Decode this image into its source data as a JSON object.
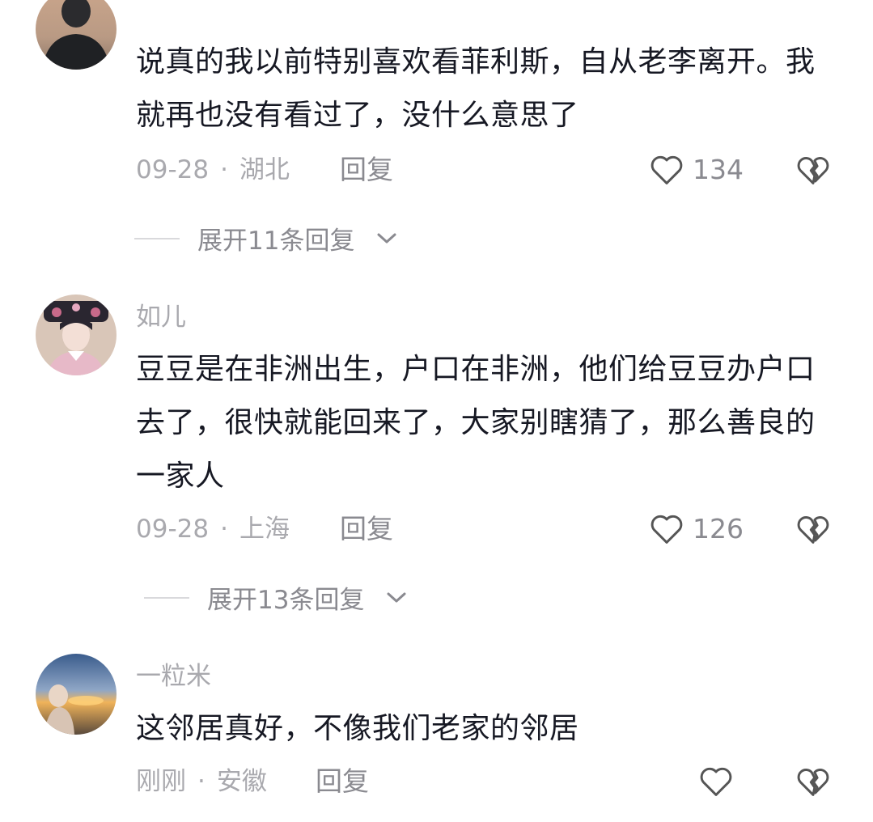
{
  "comments": [
    {
      "username": "",
      "text": "说真的我以前特别喜欢看菲利斯，自从老李离开。我就再也没有看过了，没什么意思了",
      "date": "09-28",
      "location": "湖北",
      "reply_label": "回复",
      "likes": "134",
      "expand_label": "展开11条回复"
    },
    {
      "username": "如儿",
      "text": "豆豆是在非洲出生，户口在非洲，他们给豆豆办户口去了，很快就能回来了，大家别瞎猜了，那么善良的一家人",
      "date": "09-28",
      "location": "上海",
      "reply_label": "回复",
      "likes": "126",
      "expand_label": "展开13条回复"
    },
    {
      "username": "一粒米",
      "text": "这邻居真好，不像我们老家的邻居",
      "date": "刚刚",
      "location": "安徽",
      "reply_label": "回复",
      "likes": ""
    }
  ],
  "icons": {
    "like": "heart-outline-icon",
    "dislike": "broken-heart-icon",
    "expand": "chevron-down-icon"
  },
  "colors": {
    "text": "#161823",
    "muted": "#a9a9ae",
    "secondary": "#8a8a90",
    "icon": "#555555"
  }
}
